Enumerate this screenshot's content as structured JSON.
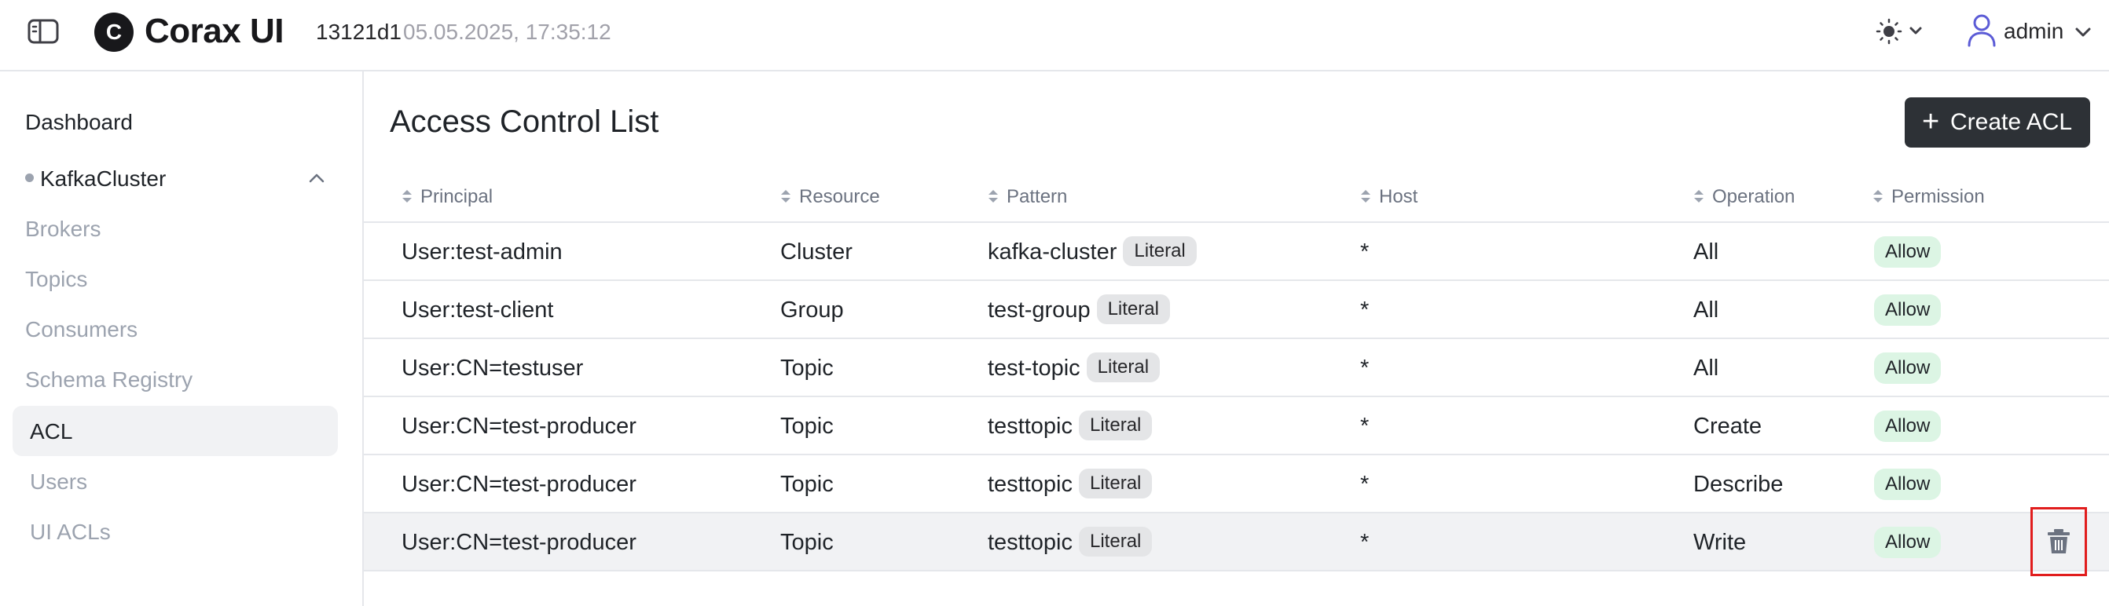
{
  "header": {
    "logo_letter": "C",
    "app_name": "Corax UI",
    "build_id": "13121d1",
    "build_timestamp": "05.05.2025, 17:35:12",
    "user_name": "admin"
  },
  "sidebar": {
    "dashboard": "Dashboard",
    "cluster": "KafkaCluster",
    "items": [
      {
        "label": "Brokers"
      },
      {
        "label": "Topics"
      },
      {
        "label": "Consumers"
      },
      {
        "label": "Schema Registry"
      },
      {
        "label": "ACL",
        "active": true
      },
      {
        "label": "Users"
      },
      {
        "label": "UI ACLs"
      }
    ]
  },
  "main": {
    "title": "Access Control List",
    "create_button": "Create ACL",
    "columns": [
      "Principal",
      "Resource",
      "Pattern",
      "Host",
      "Operation",
      "Permission"
    ],
    "rows": [
      {
        "principal": "User:test-admin",
        "resource": "Cluster",
        "pattern": "kafka-cluster",
        "pattern_type": "Literal",
        "host": "*",
        "operation": "All",
        "permission": "Allow"
      },
      {
        "principal": "User:test-client",
        "resource": "Group",
        "pattern": "test-group",
        "pattern_type": "Literal",
        "host": "*",
        "operation": "All",
        "permission": "Allow"
      },
      {
        "principal": "User:CN=testuser",
        "resource": "Topic",
        "pattern": "test-topic",
        "pattern_type": "Literal",
        "host": "*",
        "operation": "All",
        "permission": "Allow"
      },
      {
        "principal": "User:CN=test-producer",
        "resource": "Topic",
        "pattern": "testtopic",
        "pattern_type": "Literal",
        "host": "*",
        "operation": "Create",
        "permission": "Allow"
      },
      {
        "principal": "User:CN=test-producer",
        "resource": "Topic",
        "pattern": "testtopic",
        "pattern_type": "Literal",
        "host": "*",
        "operation": "Describe",
        "permission": "Allow"
      },
      {
        "principal": "User:CN=test-producer",
        "resource": "Topic",
        "pattern": "testtopic",
        "pattern_type": "Literal",
        "host": "*",
        "operation": "Write",
        "permission": "Allow"
      }
    ]
  },
  "colors": {
    "accent_user_icon": "#5b5bd6",
    "allow_badge_bg": "#dcf5e4",
    "highlight_border": "#e11d1d",
    "primary_button_bg": "#2d3136"
  },
  "icons": {
    "sidebar_toggle": "sidebar-toggle-icon",
    "theme": "sun-icon",
    "user": "user-icon",
    "delete": "trash-icon",
    "sort": "sort-icon"
  }
}
